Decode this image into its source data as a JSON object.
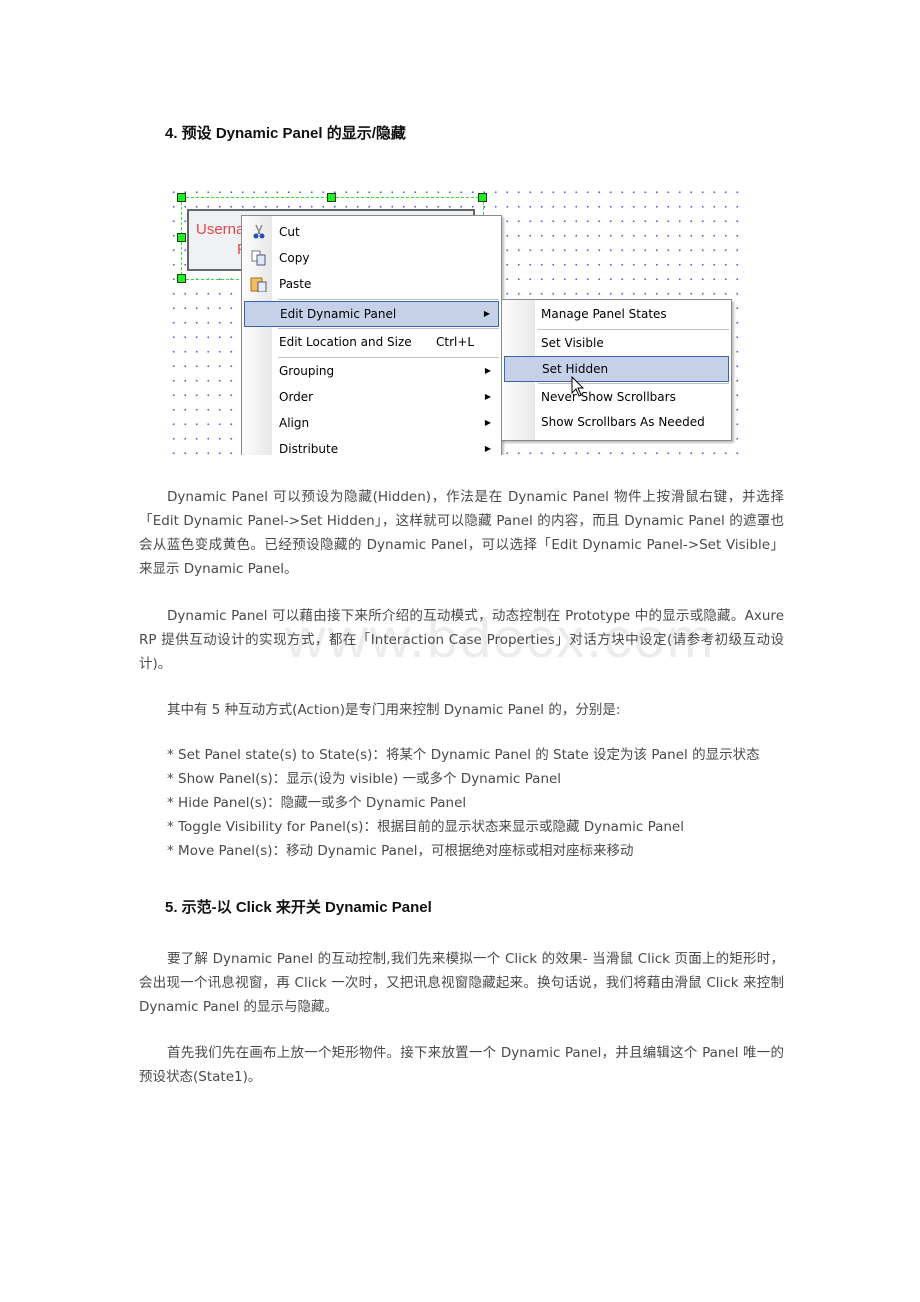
{
  "section4": {
    "heading": "4.  预设 Dynamic Panel 的显示/隐藏"
  },
  "figure": {
    "field_text_line1": "Userna",
    "field_text_line2": "P",
    "context_menu": {
      "items": [
        {
          "label": "Cut",
          "icon": "scissors-icon"
        },
        {
          "label": "Copy",
          "icon": "copy-icon"
        },
        {
          "label": "Paste",
          "icon": "paste-icon"
        },
        {
          "label": "Edit Dynamic Panel",
          "submenu": true,
          "highlighted": true
        },
        {
          "label": "Edit Location and Size",
          "shortcut": "Ctrl+L"
        },
        {
          "label": "Grouping",
          "submenu": true
        },
        {
          "label": "Order",
          "submenu": true
        },
        {
          "label": "Align",
          "submenu": true
        },
        {
          "label": "Distribute",
          "submenu": true
        }
      ]
    },
    "submenu": {
      "items": [
        {
          "label": "Manage Panel States"
        },
        {
          "label": "Set Visible"
        },
        {
          "label": "Set Hidden",
          "highlighted": true
        },
        {
          "label": "Never Show Scrollbars"
        },
        {
          "label": "Show Scrollbars As Needed"
        }
      ]
    },
    "arrow_glyph": "▶"
  },
  "paragraphs": {
    "p1": "Dynamic Panel 可以预设为隐藏(Hidden)，作法是在 Dynamic Panel 物件上按滑鼠右键，并选择「Edit Dynamic Panel->Set Hidden」，这样就可以隐藏 Panel 的内容，而且 Dynamic Panel 的遮罩也会从蓝色变成黄色。已经预设隐藏的 Dynamic Panel，可以选择「Edit Dynamic Panel->Set Visible」来显示 Dynamic Panel。",
    "p2": "Dynamic Panel 可以藉由接下来所介绍的互动模式，动态控制在 Prototype 中的显示或隐藏。Axure RP 提供互动设计的实现方式，都在「Interaction Case Properties」对话方块中设定(请参考初级互动设计)。",
    "p3": "其中有 5 种互动方式(Action)是专门用来控制 Dynamic Panel 的，分别是:"
  },
  "actions": [
    "* Set Panel state(s) to State(s)：将某个 Dynamic Panel 的 State 设定为该 Panel 的显示状态",
    "* Show Panel(s)：显示(设为 visible) 一或多个 Dynamic Panel",
    "* Hide Panel(s)：隐藏一或多个 Dynamic Panel",
    "* Toggle Visibility for Panel(s)：根据目前的显示状态来显示或隐藏 Dynamic Panel",
    "* Move Panel(s)：移动 Dynamic Panel，可根据绝对座标或相对座标来移动"
  ],
  "section5": {
    "heading": "5.  示范-以 Click 来开关 Dynamic Panel",
    "p4": "要了解 Dynamic Panel 的互动控制,我们先来模拟一个 Click 的效果- 当滑鼠 Click 页面上的矩形时，会出现一个讯息视窗，再 Click 一次时，又把讯息视窗隐藏起来。换句话说，我们将藉由滑鼠 Click 来控制 Dynamic Panel 的显示与隐藏。",
    "p5": "首先我们先在画布上放一个矩形物件。接下来放置一个 Dynamic Panel，并且编辑这个 Panel 唯一的预设状态(State1)。"
  },
  "watermark": "www.bdocx.com",
  "colors": {
    "highlight": "#c5d1e8",
    "highlight_border": "#3c64a8",
    "selection_handle": "#22ee22",
    "field_text": "#e04848",
    "grid_dot": "#5a5af0"
  }
}
